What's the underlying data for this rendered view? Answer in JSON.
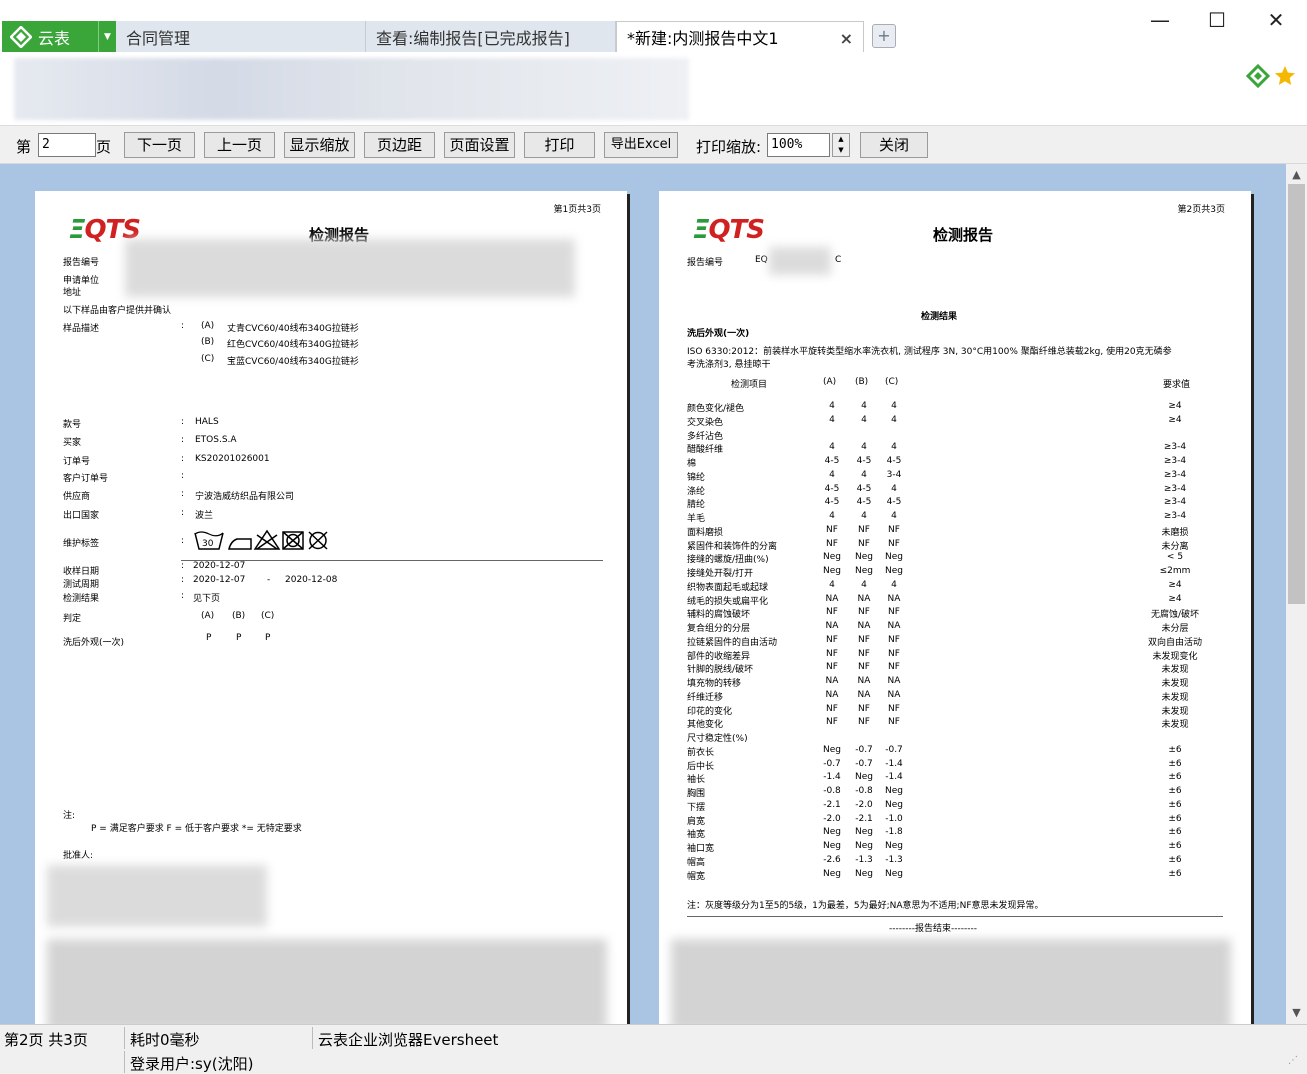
{
  "app": {
    "name": "云表"
  },
  "tabs": [
    {
      "label": "合同管理"
    },
    {
      "label": "查看:编制报告[已完成报告]"
    },
    {
      "label": "*新建:内测报告中文1",
      "close": "×"
    }
  ],
  "window": {
    "minimize": "—",
    "maximize": "☐",
    "close": "✕"
  },
  "toolbar": {
    "page_prefix": "第",
    "page_value": "2",
    "page_suffix": "页",
    "next_label": "下一页",
    "prev_label": "上一页",
    "zoom_label": "显示缩放",
    "margin_label": "页边距",
    "pagesetup_label": "页面设置",
    "print_label": "打印",
    "export_label": "导出Excel",
    "print_zoom_label": "打印缩放:",
    "print_zoom_value": "100%",
    "close_label": "关闭"
  },
  "page1": {
    "page_no": "第1页共3页",
    "logo": "EQTS",
    "title": "检测报告",
    "fields_top": [
      "报告编号",
      "申请单位",
      "地址"
    ],
    "confirm_note": "以下样品由客户提供并确认",
    "sample_label": "样品描述",
    "samples": [
      {
        "code": "(A)",
        "desc": "丈青CVC60/40线布340G拉链衫"
      },
      {
        "code": "(B)",
        "desc": "红色CVC60/40线布340G拉链衫"
      },
      {
        "code": "(C)",
        "desc": "宝蓝CVC60/40线布340G拉链衫"
      }
    ],
    "info": [
      {
        "label": "款号",
        "value": "HALS"
      },
      {
        "label": "买家",
        "value": "ETOS.S.A"
      },
      {
        "label": "订单号",
        "value": "KS20201026001"
      },
      {
        "label": "客户订单号",
        "value": ""
      },
      {
        "label": "供应商",
        "value": "宁波浩威纺织品有限公司"
      },
      {
        "label": "出口国家",
        "value": "波兰"
      }
    ],
    "care_label": "维护标签",
    "care_wash_temp": "30",
    "dates": [
      {
        "label": "收样日期",
        "value": "2020-12-07"
      },
      {
        "label": "测试周期",
        "value": "2020-12-07",
        "dash": "-",
        "value2": "2020-12-08"
      },
      {
        "label": "检测结果",
        "value": "见下页"
      }
    ],
    "verdict_label": "判定",
    "verdict_cols": [
      "(A)",
      "(B)",
      "(C)"
    ],
    "verdict_row_label": "洗后外观(一次)",
    "verdict_vals": [
      "P",
      "P",
      "P"
    ],
    "note_label": "注:",
    "note_text": "P = 满足客户要求   F = 低于客户要求   *= 无特定要求",
    "approver": "批准人:",
    "colon": ":"
  },
  "page2": {
    "page_no": "第2页共3页",
    "logo": "EQTS",
    "title": "检测报告",
    "report_no_label": "报告编号",
    "report_no_value_a": "EQ",
    "report_no_value_b": "C",
    "section": "检测结果",
    "test_name": "洗后外观(一次)",
    "method_1": "ISO 6330:2012：前装样水平旋转类型缩水率洗衣机, 测试程序 3N, 30°C用100% 聚酯纤维总装载2kg, 使用20克无磷参",
    "method_2": "考洗涤剂3, 悬挂晾干",
    "header": {
      "item": "检测项目",
      "a": "(A)",
      "b": "(B)",
      "c": "(C)",
      "req": "要求值"
    },
    "rows": [
      [
        "颜色变化/褪色",
        "4",
        "4",
        "4",
        "≥4"
      ],
      [
        "交叉染色",
        "4",
        "4",
        "4",
        "≥4"
      ],
      [
        "多纤沾色",
        "",
        "",
        "",
        ""
      ],
      [
        "醋酸纤维",
        "4",
        "4",
        "4",
        "≥3-4"
      ],
      [
        "棉",
        "4-5",
        "4-5",
        "4-5",
        "≥3-4"
      ],
      [
        "锦纶",
        "4",
        "4",
        "3-4",
        "≥3-4"
      ],
      [
        "涤纶",
        "4-5",
        "4-5",
        "4",
        "≥3-4"
      ],
      [
        "腈纶",
        "4-5",
        "4-5",
        "4-5",
        "≥3-4"
      ],
      [
        "羊毛",
        "4",
        "4",
        "4",
        "≥3-4"
      ],
      [
        "面料磨损",
        "NF",
        "NF",
        "NF",
        "未磨损"
      ],
      [
        "紧固件和装饰件的分离",
        "NF",
        "NF",
        "NF",
        "未分离"
      ],
      [
        "接缝的螺旋/扭曲(%)",
        "Neg",
        "Neg",
        "Neg",
        "< 5"
      ],
      [
        "接缝处开裂/打开",
        "Neg",
        "Neg",
        "Neg",
        "≤2mm"
      ],
      [
        "织物表面起毛或起球",
        "4",
        "4",
        "4",
        "≥4"
      ],
      [
        "绒毛的损失或扁平化",
        "NA",
        "NA",
        "NA",
        "≥4"
      ],
      [
        "辅料的腐蚀破坏",
        "NF",
        "NF",
        "NF",
        "无腐蚀/破坏"
      ],
      [
        "复合组分的分层",
        "NA",
        "NA",
        "NA",
        "未分层"
      ],
      [
        "拉链紧固件的自由活动",
        "NF",
        "NF",
        "NF",
        "双向自由活动"
      ],
      [
        "部件的收缩差异",
        "NF",
        "NF",
        "NF",
        "未发现变化"
      ],
      [
        "针脚的脱线/破坏",
        "NF",
        "NF",
        "NF",
        "未发现"
      ],
      [
        "填充物的转移",
        "NA",
        "NA",
        "NA",
        "未发现"
      ],
      [
        "纤维迁移",
        "NA",
        "NA",
        "NA",
        "未发现"
      ],
      [
        "印花的变化",
        "NF",
        "NF",
        "NF",
        "未发现"
      ],
      [
        "其他变化",
        "NF",
        "NF",
        "NF",
        "未发现"
      ],
      [
        "尺寸稳定性(%)",
        "",
        "",
        "",
        ""
      ],
      [
        "前衣长",
        "Neg",
        "-0.7",
        "-0.7",
        "±6"
      ],
      [
        "后中长",
        "-0.7",
        "-0.7",
        "-1.4",
        "±6"
      ],
      [
        "袖长",
        "-1.4",
        "Neg",
        "-1.4",
        "±6"
      ],
      [
        "胸围",
        "-0.8",
        "-0.8",
        "Neg",
        "±6"
      ],
      [
        "下摆",
        "-2.1",
        "-2.0",
        "Neg",
        "±6"
      ],
      [
        "肩宽",
        "-2.0",
        "-2.1",
        "-1.0",
        "±6"
      ],
      [
        "袖宽",
        "Neg",
        "Neg",
        "-1.8",
        "±6"
      ],
      [
        "袖口宽",
        "Neg",
        "Neg",
        "Neg",
        "±6"
      ],
      [
        "帽高",
        "-2.6",
        "-1.3",
        "-1.3",
        "±6"
      ],
      [
        "帽宽",
        "Neg",
        "Neg",
        "Neg",
        "±6"
      ]
    ],
    "footnote": "注：灰度等级分为1至5的5级，1为最差，5为最好;NA意思为不适用;NF意思未发现异常。",
    "end_text": "--------报告结束--------"
  },
  "status": {
    "page_info": "第2页 共3页",
    "elapsed": "耗时0毫秒",
    "browser": "云表企业浏览器Eversheet",
    "user": "登录用户:sy(沈阳)"
  },
  "colors": {
    "app_green": "#3aa63a",
    "viewport_bg": "#aac5e4",
    "logo_red": "#d02020",
    "logo_green": "#2a9a3a"
  }
}
